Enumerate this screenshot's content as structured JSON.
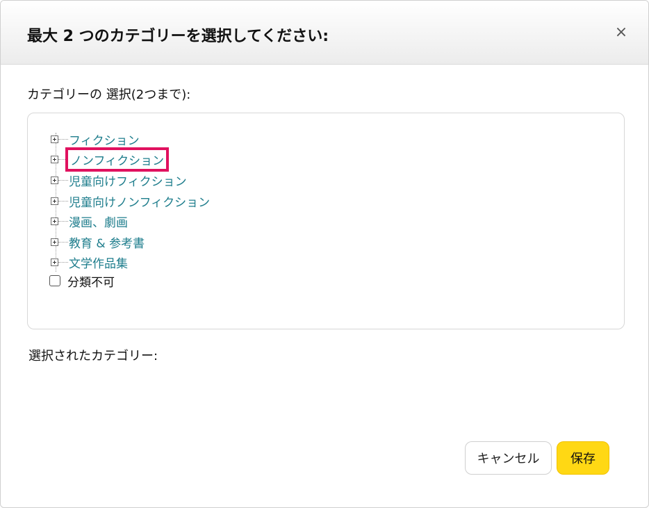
{
  "dialog": {
    "title": "最大 2 つのカテゴリーを選択してください:",
    "close_label": "×"
  },
  "section_label": "カテゴリーの 選択(2つまで):",
  "tree": {
    "items": [
      {
        "label": "フィクション",
        "expandable": true,
        "highlighted": false
      },
      {
        "label": "ノンフィクション",
        "expandable": true,
        "highlighted": true
      },
      {
        "label": "児童向けフィクション",
        "expandable": true,
        "highlighted": false
      },
      {
        "label": "児童向けノンフィクション",
        "expandable": true,
        "highlighted": false
      },
      {
        "label": "漫画、劇画",
        "expandable": true,
        "highlighted": false
      },
      {
        "label": "教育 & 参考書",
        "expandable": true,
        "highlighted": false
      },
      {
        "label": "文学作品集",
        "expandable": true,
        "highlighted": false
      }
    ],
    "checkbox_item": {
      "label": "分類不可",
      "checked": false
    }
  },
  "selected_label": "選択されたカテゴリー:",
  "buttons": {
    "cancel": "キャンセル",
    "save": "保存"
  },
  "colors": {
    "link": "#1e7d8c",
    "highlight_border": "#e0115f",
    "save_button": "#ffd814"
  },
  "icons": {
    "close": "close-icon",
    "expander": "plus-box-icon"
  }
}
